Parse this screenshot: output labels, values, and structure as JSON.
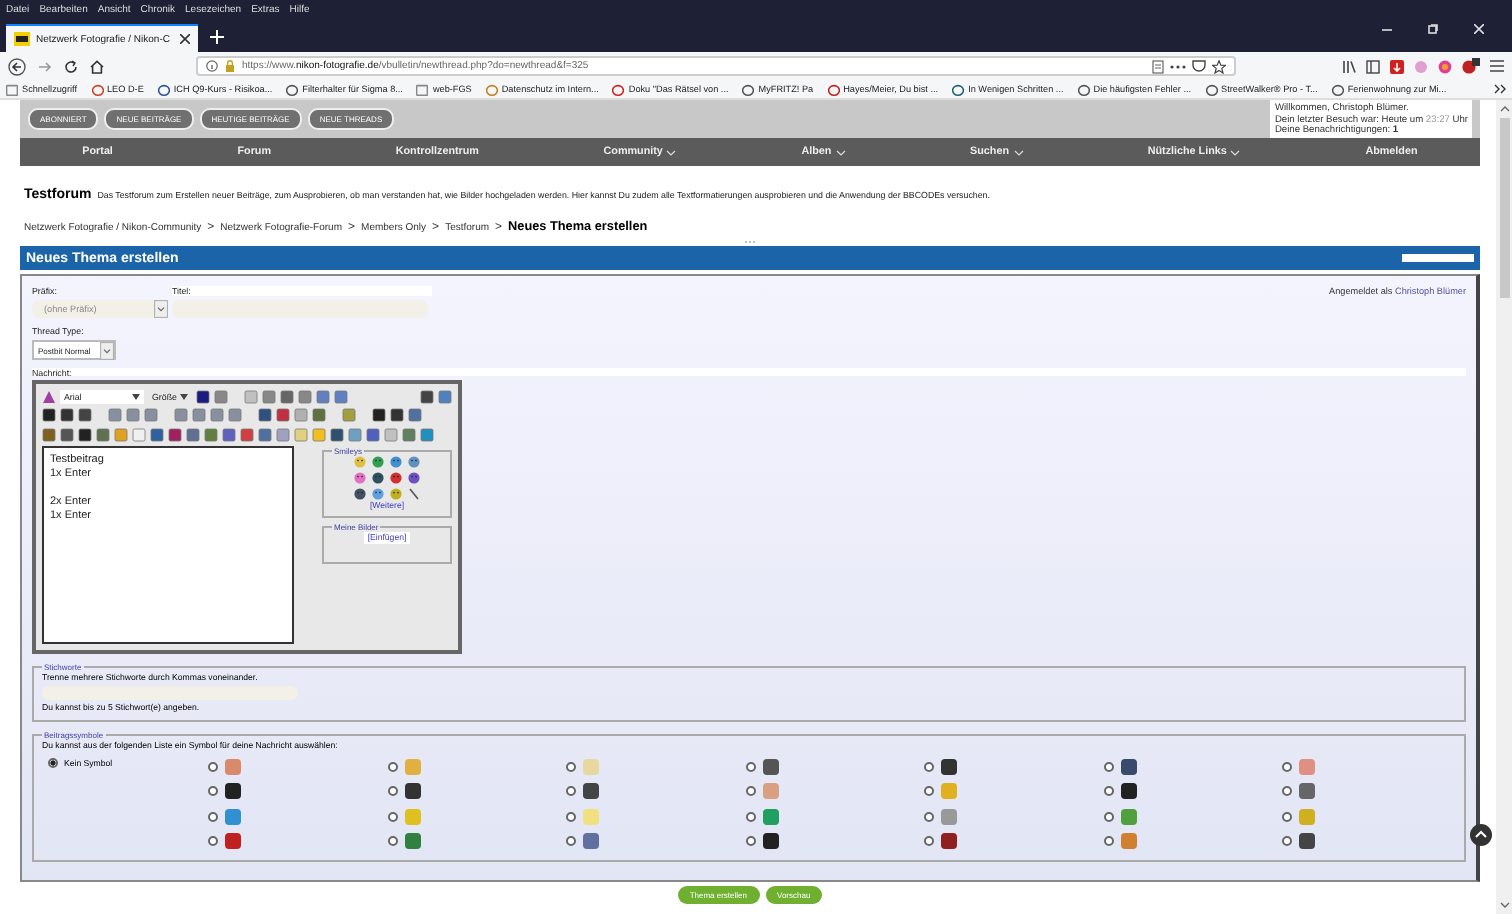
{
  "menu_bar": [
    "Datei",
    "Bearbeiten",
    "Ansicht",
    "Chronik",
    "Lesezeichen",
    "Extras",
    "Hilfe"
  ],
  "tab": {
    "title": "Netzwerk Fotografie / Nikon-C"
  },
  "address_bar": {
    "url_prefix": "https://www.",
    "url_domain": "nikon-fotografie.de",
    "url_path": "/vbulletin/newthread.php?do=newthread&f=325"
  },
  "bookmarks": [
    "Schnellzugriff",
    "LEO D-E",
    "ICH Q9-Kurs - Risikoa...",
    "Filterhalter für Sigma 8...",
    "web-FGS",
    "Datenschutz im Intern...",
    "Doku \"Das Rätsel von ...",
    "MyFRITZ! Pa",
    "Hayes/Meier, Du bist ...",
    "In Wenigen Schritten ...",
    "Die häufigsten Fehler ...",
    "StreetWalker® Pro - T...",
    "Ferienwohnung zur Mi..."
  ],
  "quick_buttons": [
    "ABONNIERT",
    "NEUE BEITRÄGE",
    "HEUTIGE BEITRÄGE",
    "NEUE THREADS"
  ],
  "welcome": {
    "greeting": "Willkommen, Christoph Blümer.",
    "last_visit_label": "Dein letzter Besuch war: Heute um",
    "last_visit_time": "23:27",
    "last_visit_unit": "Uhr",
    "notifications_label": "Deine Benachrichtigungen:",
    "notifications_count": "1"
  },
  "nav": [
    {
      "label": "Portal",
      "dropdown": false
    },
    {
      "label": "Forum",
      "dropdown": false
    },
    {
      "label": "Kontrollzentrum",
      "dropdown": false
    },
    {
      "label": "Community",
      "dropdown": true
    },
    {
      "label": "Alben",
      "dropdown": true
    },
    {
      "label": "Suchen",
      "dropdown": true
    },
    {
      "label": "Nützliche Links",
      "dropdown": true
    },
    {
      "label": "Abmelden",
      "dropdown": false
    }
  ],
  "forum": {
    "title": "Testforum",
    "description": "Das Testforum zum Erstellen neuer Beiträge, zum Ausprobieren, ob man verstanden hat, wie Bilder hochgeladen werden. Hier kannst Du zudem alle Textformatierungen ausprobieren und die Anwendung der BBCODEs versuchen."
  },
  "breadcrumb": {
    "items": [
      "Netzwerk Fotografie / Nikon-Community",
      "Netzwerk Fotografie-Forum",
      "Members Only",
      "Testforum"
    ],
    "separator": ">",
    "current": "Neues Thema erstellen"
  },
  "panel_title": "Neues Thema erstellen",
  "form": {
    "prefix_label": "Präfix:",
    "prefix_value": "(ohne Präfix)",
    "title_label": "Titel:",
    "logged_in_label": "Angemeldet als",
    "logged_in_user": "Christoph Blümer",
    "thread_type_label": "Thread Type:",
    "thread_type_value": "Postbit Normal",
    "message_label": "Nachricht:"
  },
  "editor": {
    "font": "Arial",
    "size": "Größe",
    "paragraphs": [
      [
        "Testbeitrag",
        "1x Enter"
      ],
      [
        "2x Enter",
        "1x Enter"
      ]
    ],
    "smileys_legend": "Smileys",
    "smileys_more": "[Weitere]",
    "images_legend": "Meine Bilder",
    "images_insert": "[Einfügen]"
  },
  "tags": {
    "legend": "Stichworte",
    "hint": "Trenne mehrere Stichworte durch Kommas voneinander.",
    "note": "Du kannst bis zu 5 Stichwort(e) angeben."
  },
  "post_icons": {
    "legend": "Beitragssymbole",
    "hint": "Du kannst aus der folgenden Liste ein Symbol für deine Nachricht auswählen:",
    "items": [
      {
        "label": "Kein Symbol",
        "selected": true
      },
      {
        "selected": false,
        "color": "#d98a6a"
      },
      {
        "selected": false,
        "color": "#e0b040"
      },
      {
        "selected": false,
        "color": "#e8d8a0"
      },
      {
        "selected": false,
        "color": "#555555"
      },
      {
        "selected": false,
        "color": "#333333"
      },
      {
        "selected": false,
        "color": "#3a4a6a"
      },
      {
        "selected": false,
        "color": "#e09080"
      },
      {
        "selected": false,
        "color": "#222222"
      },
      {
        "selected": false,
        "color": "#333333"
      },
      {
        "selected": false,
        "color": "#444444"
      },
      {
        "selected": false,
        "color": "#d8a080"
      },
      {
        "selected": false,
        "color": "#e0b020"
      },
      {
        "selected": false,
        "color": "#222222"
      },
      {
        "selected": false,
        "color": "#666666"
      },
      {
        "selected": false,
        "color": "#3090d0"
      },
      {
        "selected": false,
        "color": "#e0c020"
      },
      {
        "selected": false,
        "color": "#f0e080"
      },
      {
        "selected": false,
        "color": "#20a060"
      },
      {
        "selected": false,
        "color": "#999999"
      },
      {
        "selected": false,
        "color": "#50a040"
      },
      {
        "selected": false,
        "color": "#d0b020"
      },
      {
        "selected": false,
        "color": "#c02020"
      },
      {
        "selected": false,
        "color": "#308040"
      },
      {
        "selected": false,
        "color": "#6070a0"
      },
      {
        "selected": false,
        "color": "#222222"
      },
      {
        "selected": false,
        "color": "#902020"
      },
      {
        "selected": false,
        "color": "#d08030"
      },
      {
        "selected": false,
        "color": "#444444"
      }
    ]
  },
  "buttons": [
    "Thema erstellen",
    "Vorschau"
  ]
}
